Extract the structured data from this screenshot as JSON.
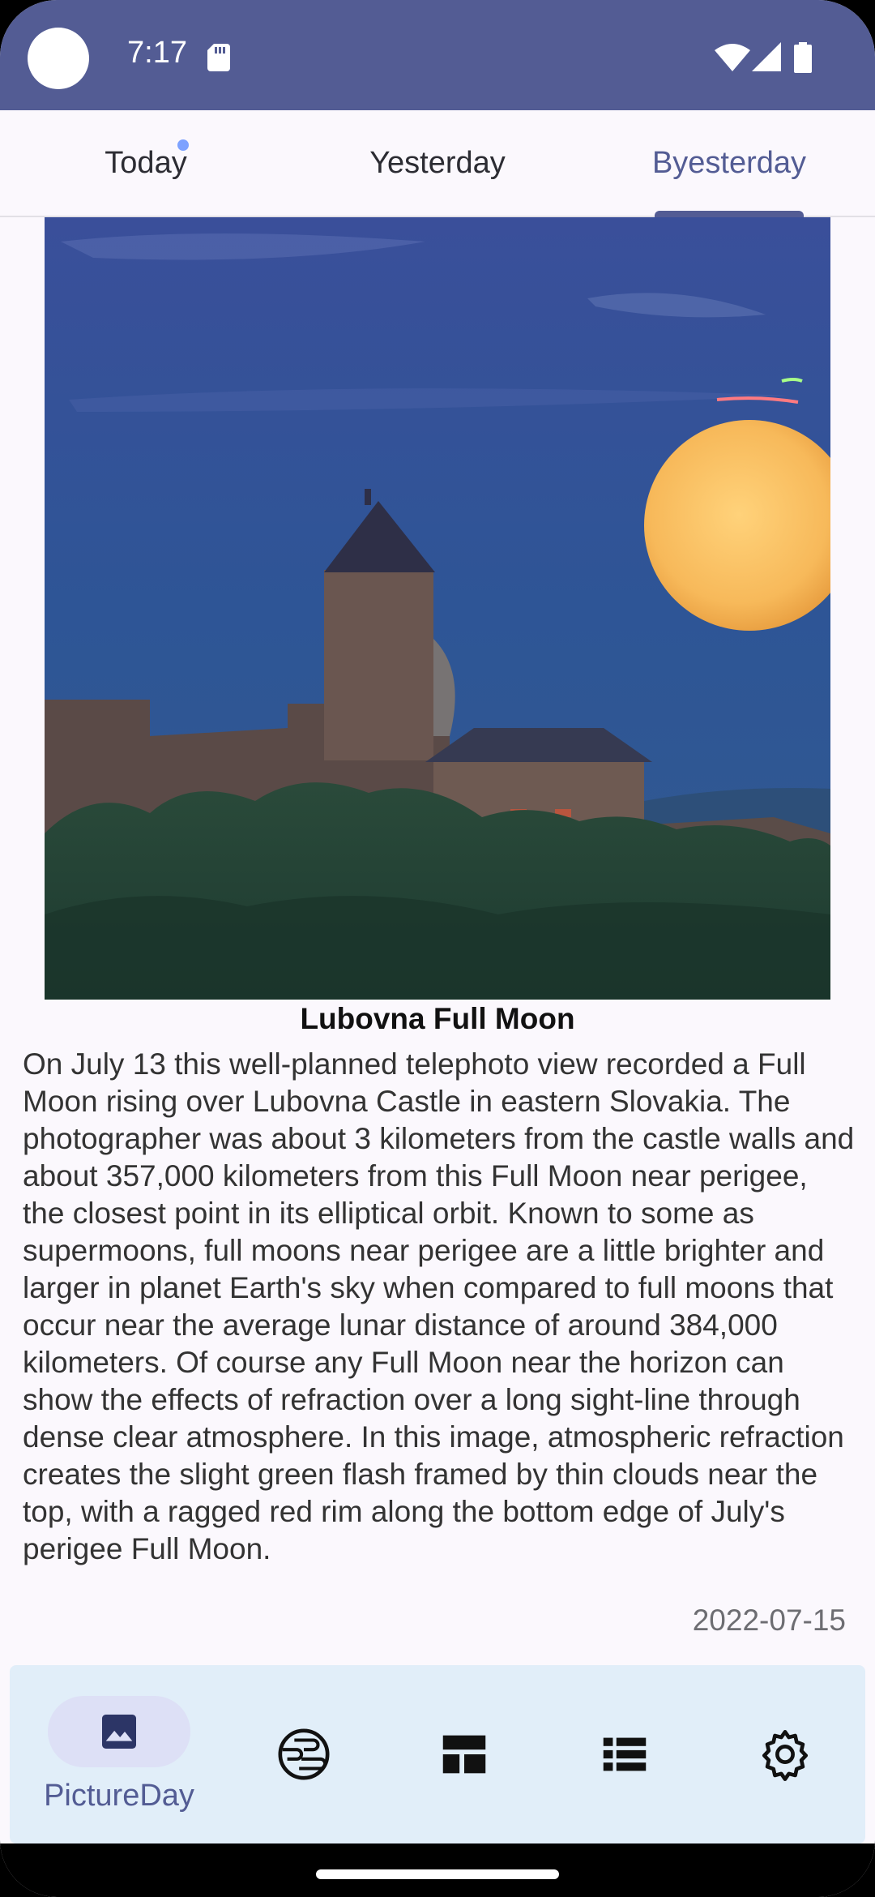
{
  "status_bar": {
    "time": "7:17"
  },
  "tabs": [
    {
      "label": "Today",
      "active": false,
      "has_dot": true
    },
    {
      "label": "Yesterday",
      "active": false
    },
    {
      "label": "Byesterday",
      "active": true
    }
  ],
  "article": {
    "title": "Lubovna Full Moon",
    "description": "On July 13 this well-planned telephoto view recorded a Full Moon rising over Lubovna Castle in eastern Slovakia. The photographer was about 3 kilometers from the castle walls and about 357,000 kilometers from this Full Moon near perigee, the closest point in its elliptical orbit. Known to some as supermoons, full moons near perigee are a little brighter and larger in planet Earth's sky when compared to full moons that occur near the average lunar distance of around 384,000 kilometers. Of course any Full Moon near the horizon can show the effects of refraction over a long sight-line through dense clear atmosphere. In this image, atmospheric refraction creates the slight green flash framed by thin clouds near the top, with a ragged red rim along the bottom edge of July's perigee Full Moon.",
    "date": "2022-07-15"
  },
  "bottom_nav": {
    "items": [
      {
        "label": "PictureDay",
        "icon": "image-icon",
        "selected": true
      },
      {
        "icon": "earth-icon"
      },
      {
        "icon": "dashboard-icon"
      },
      {
        "icon": "list-icon"
      },
      {
        "icon": "gear-icon"
      }
    ]
  },
  "colors": {
    "primary": "#535c94",
    "tab_dot": "#7da2ff",
    "nav_background": "#e1eef9",
    "nav_pill": "#dde0f6",
    "sky": "#2f5497"
  }
}
